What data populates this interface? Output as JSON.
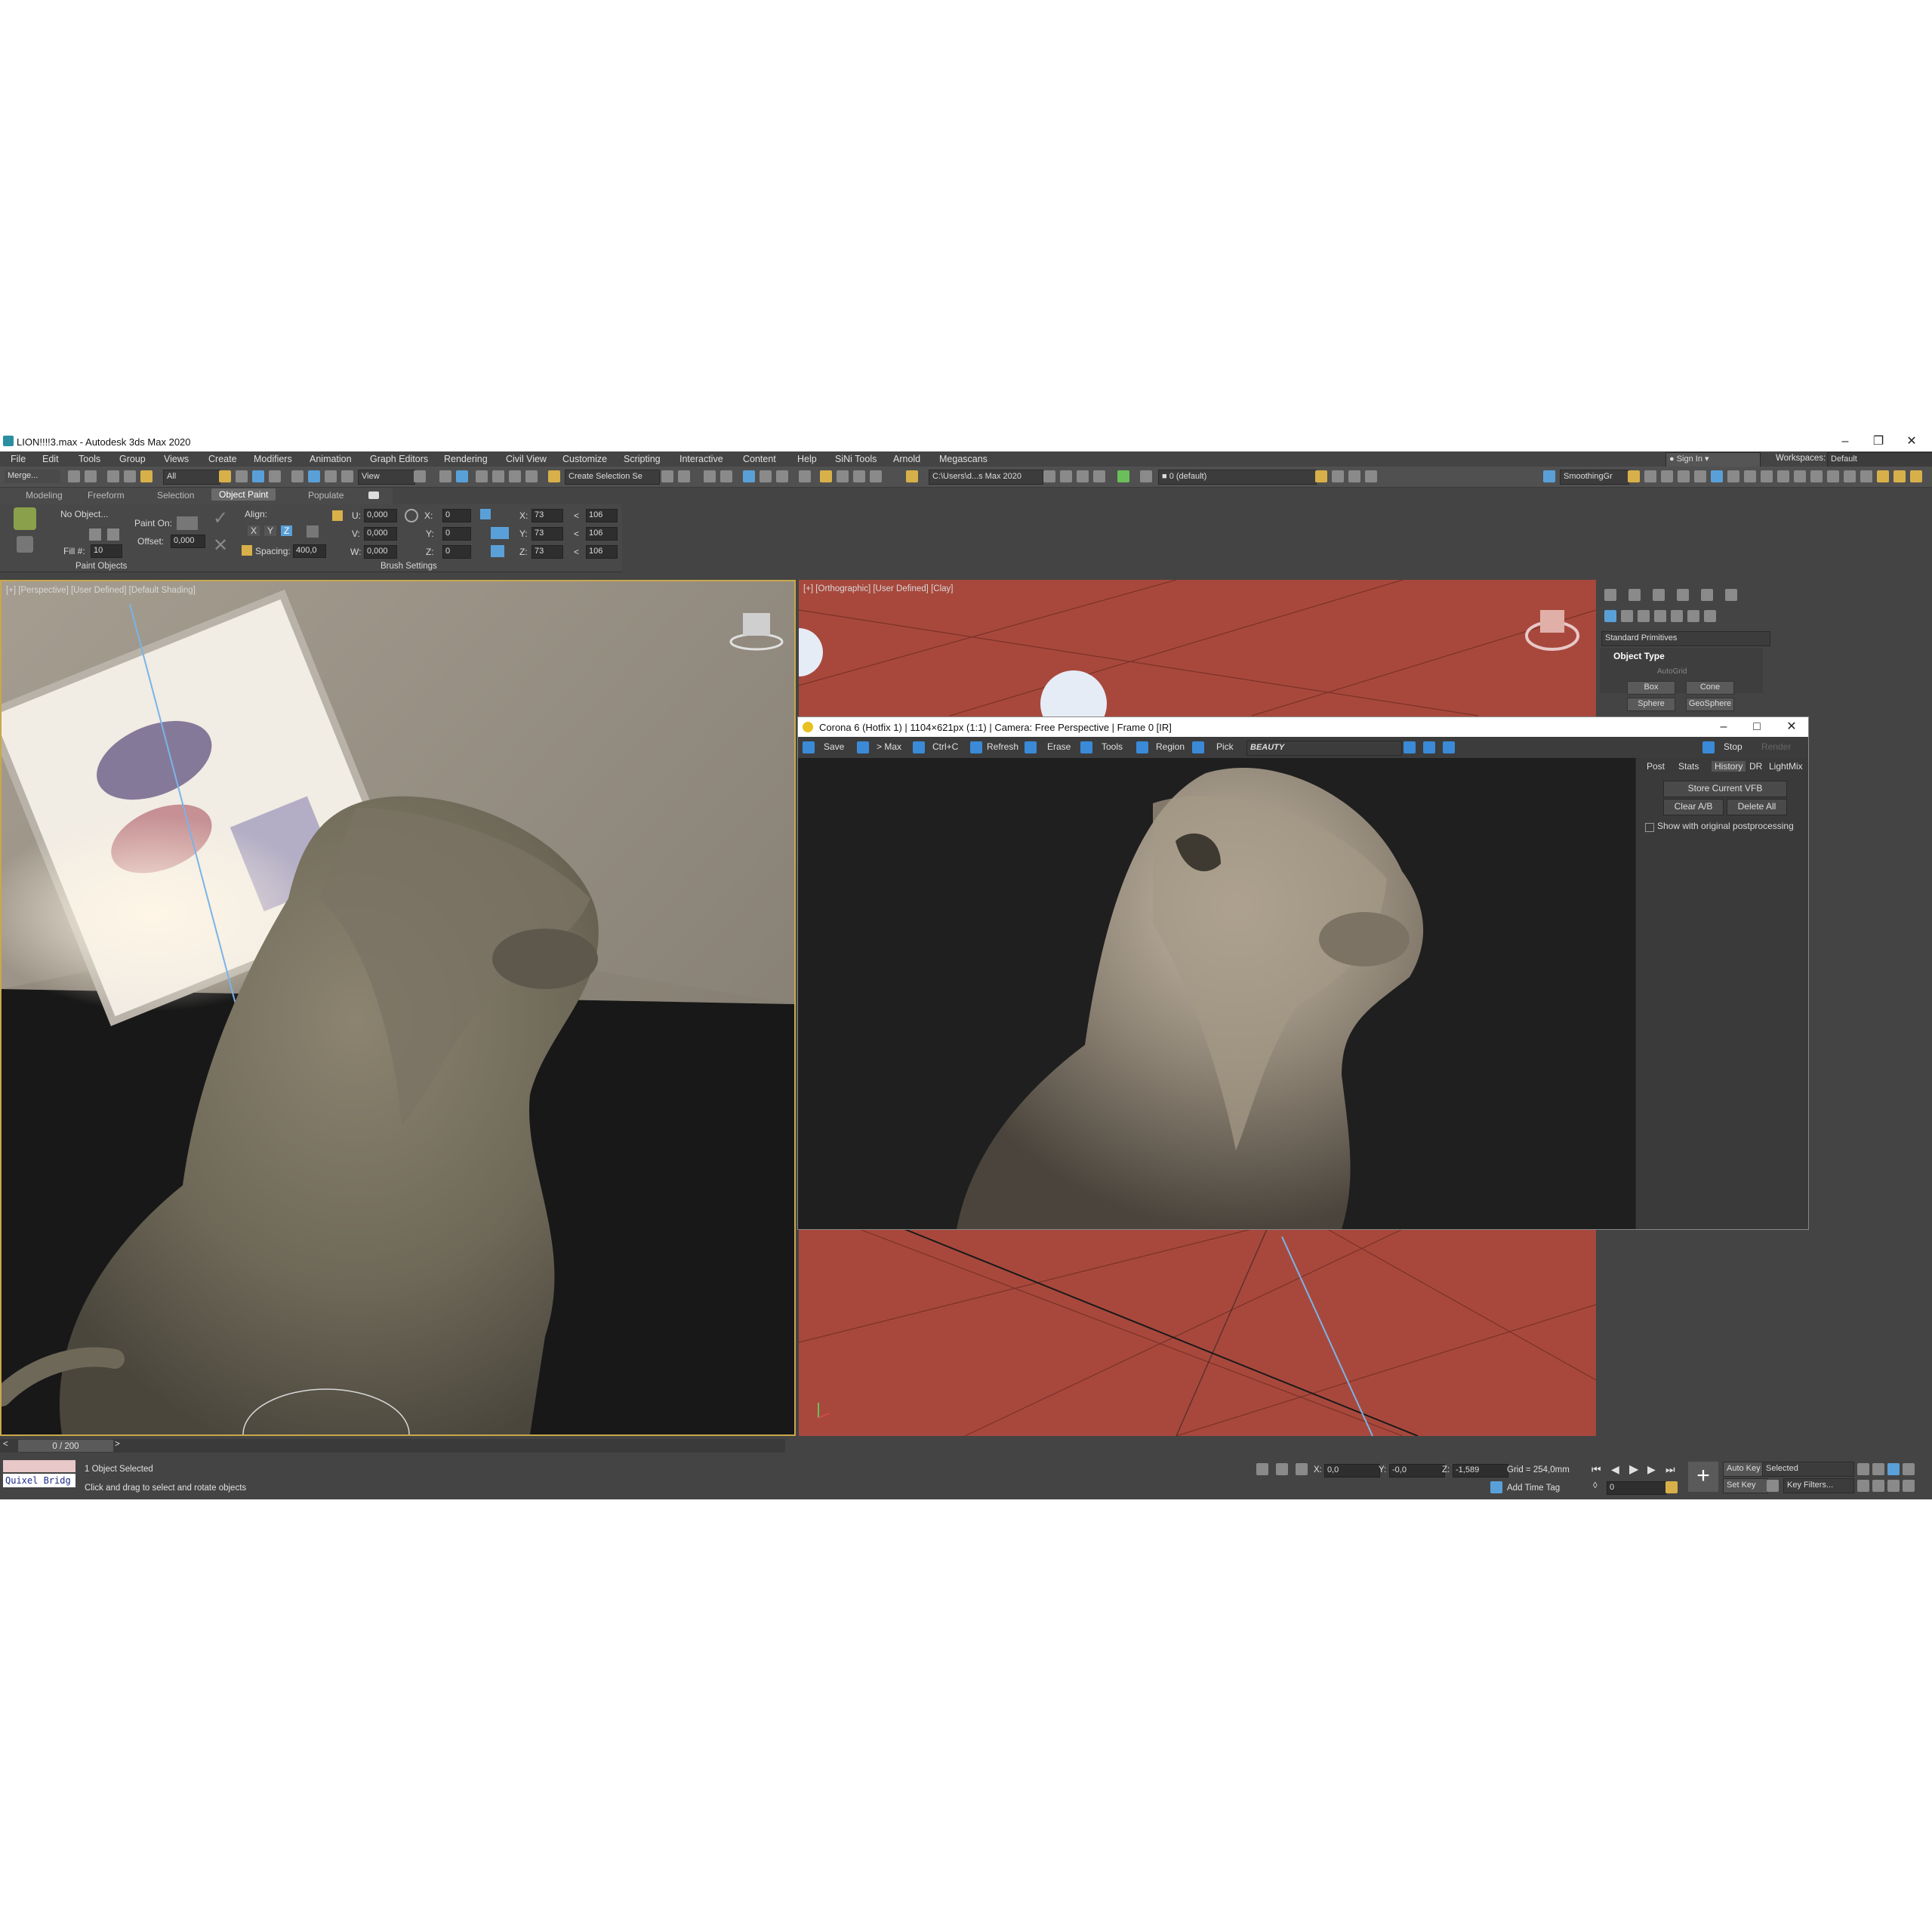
{
  "window": {
    "title": "LION!!!!3.max - Autodesk 3ds Max 2020"
  },
  "menu": [
    "File",
    "Edit",
    "Tools",
    "Group",
    "Views",
    "Create",
    "Modifiers",
    "Animation",
    "Graph Editors",
    "Rendering",
    "Civil View",
    "Customize",
    "Scripting",
    "Interactive",
    "Content",
    "Help",
    "SiNi Tools",
    "Arnold",
    "Megascans"
  ],
  "account": {
    "sign_in": "Sign In",
    "workspaces_label": "Workspaces:",
    "workspace_value": "Default"
  },
  "toolbar": {
    "merge": "Merge...",
    "filter": "All",
    "ref_coord": "View",
    "selection_set": "Create Selection Se",
    "path": "C:\\Users\\d...s Max 2020",
    "layer": "0 (default)",
    "smoothing": "SmoothingGr"
  },
  "ribbon_tabs": [
    "Modeling",
    "Freeform",
    "Selection",
    "Object Paint",
    "Populate"
  ],
  "ribbon": {
    "no_object": "No Object...",
    "fill_label": "Fill #:",
    "fill_value": "10",
    "paint_on": "Paint On:",
    "offset_label": "Offset:",
    "offset_value": "0,000",
    "align": "Align:",
    "axes": [
      "X",
      "Y",
      "Z"
    ],
    "spacing_label": "Spacing:",
    "spacing_value": "400,0",
    "u_label": "U:",
    "u_value": "0,000",
    "v_label": "V:",
    "v_value": "0,000",
    "w_label": "W:",
    "w_value": "0,000",
    "rx_label": "X:",
    "rx_value": "0",
    "ry_label": "Y:",
    "ry_value": "0",
    "rz_label": "Z:",
    "rz_value": "0",
    "sx_label": "X:",
    "sx_value": "73",
    "sy_label": "Y:",
    "sy_value": "73",
    "sz_label": "Z:",
    "sz_value": "73",
    "lt": "<",
    "mx_value": "106",
    "my_value": "106",
    "mz_value": "106",
    "group_paint": "Paint Objects",
    "group_brush": "Brush Settings"
  },
  "viewports": {
    "perspective_label": "[+] [Perspective] [User Defined] [Default Shading]",
    "ortho_label": "[+] [Orthographic] [User Defined] [Clay]"
  },
  "command_panel": {
    "category": "Standard Primitives",
    "rollout": "Object Type",
    "autogrid": "AutoGrid",
    "buttons": [
      "Box",
      "Cone",
      "Sphere",
      "GeoSphere"
    ]
  },
  "vfb": {
    "title": "Corona 6 (Hotfix 1) | 1104×621px (1:1) | Camera: Free Perspective | Frame 0 [IR]",
    "tools": [
      "Save",
      "> Max",
      "Ctrl+C",
      "Refresh",
      "Erase",
      "Tools",
      "Region",
      "Pick"
    ],
    "channel": "BEAUTY",
    "stop": "Stop",
    "render": "Render",
    "tabs": [
      "Post",
      "Stats",
      "History",
      "DR",
      "LightMix"
    ],
    "store": "Store Current VFB",
    "clear_ab": "Clear A/B",
    "delete_all": "Delete All",
    "show_original": "Show with original postprocessing"
  },
  "status": {
    "time_slider": "0 / 200",
    "script_listener": "Quixel Bridg",
    "selected": "1 Object Selected",
    "prompt": "Click and drag to select and rotate objects",
    "x_label": "X:",
    "x_value": "0,0",
    "y_label": "Y:",
    "y_value": "-0,0",
    "z_label": "Z:",
    "z_value": "-1,589",
    "grid": "Grid = 254,0mm",
    "add_time_tag": "Add Time Tag",
    "auto_key": "Auto Key",
    "set_key": "Set Key",
    "key_mode": "Selected",
    "key_filters": "Key Filters...",
    "frame": "0"
  }
}
